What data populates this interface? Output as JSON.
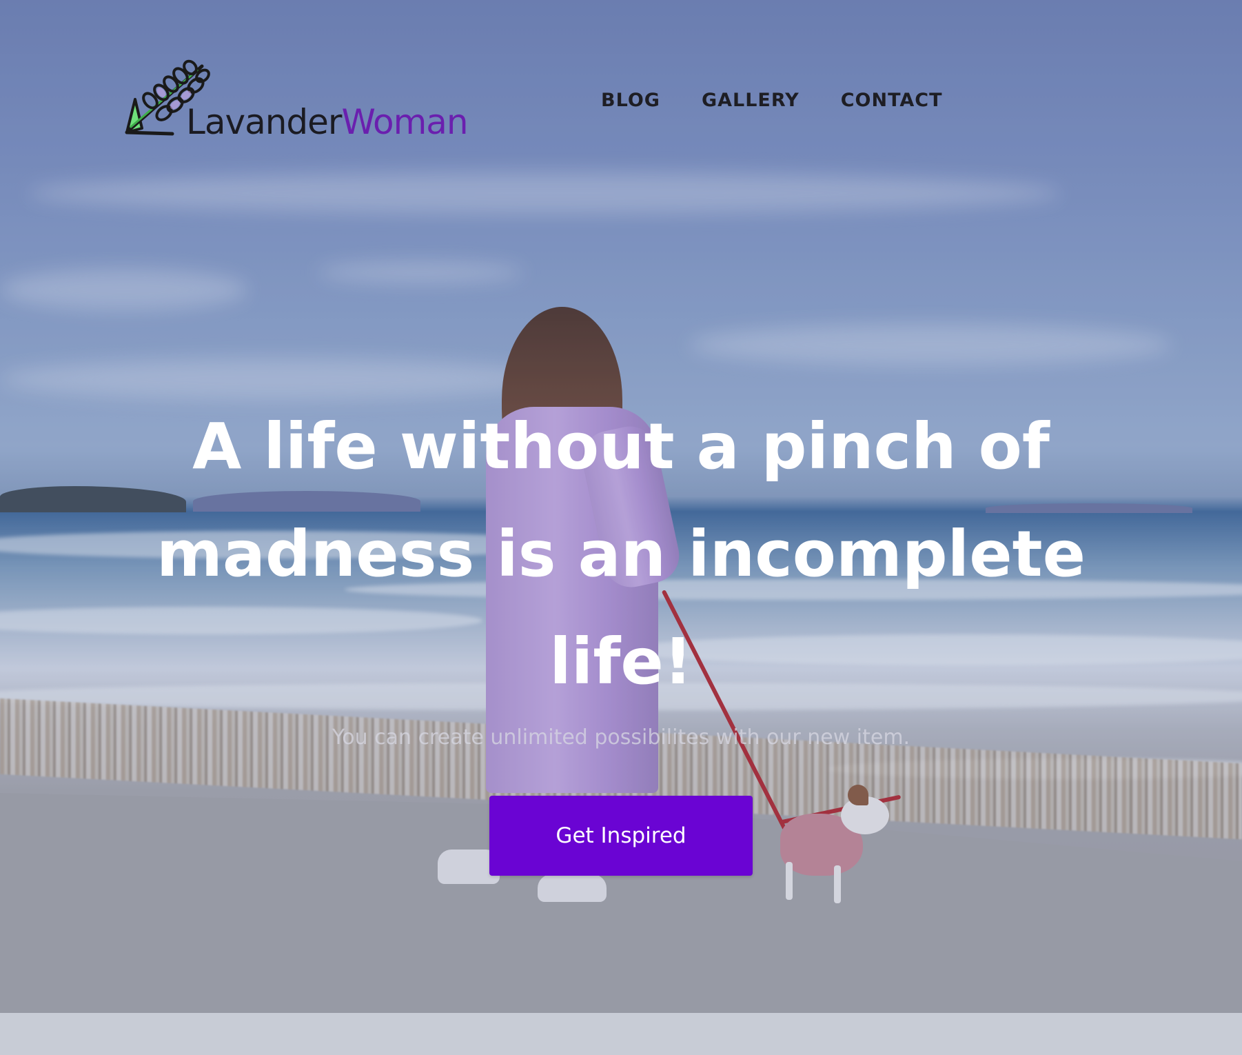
{
  "brand": {
    "name_part1": "Lavander",
    "name_part2": "Woman",
    "logo_icon": "lavender-sprig-icon"
  },
  "nav": {
    "items": [
      {
        "label": "BLOG"
      },
      {
        "label": "GALLERY"
      },
      {
        "label": "CONTACT"
      }
    ]
  },
  "hero": {
    "headline": "A life without a pinch of madness is an incomplete life!",
    "subtext": "You can create unlimited possibilites with our new item.",
    "cta_label": "Get Inspired",
    "background_image": "woman-walking-dog-on-beach"
  },
  "colors": {
    "accent": "#6a04d3",
    "brand_purple": "#6a1fae",
    "nav_text": "#1e1e24",
    "footer_band": "#c8ccd6"
  }
}
